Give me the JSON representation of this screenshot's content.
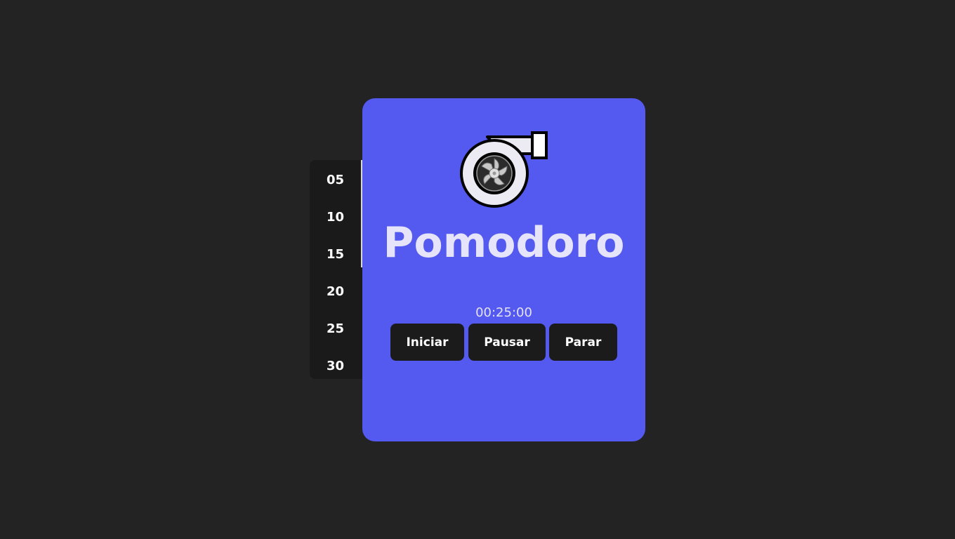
{
  "durations": [
    {
      "label": "05"
    },
    {
      "label": "10"
    },
    {
      "label": "15"
    },
    {
      "label": "20"
    },
    {
      "label": "25"
    },
    {
      "label": "30"
    }
  ],
  "app": {
    "logo_icon": "turbocharger-icon",
    "title": "Pomodoro",
    "timer": "00:25:00"
  },
  "controls": {
    "start_label": "Iniciar",
    "pause_label": "Pausar",
    "stop_label": "Parar"
  },
  "colors": {
    "background": "#232323",
    "card": "#5459f0",
    "button": "#1b1b1b",
    "sidebar": "#1a1a1a"
  }
}
